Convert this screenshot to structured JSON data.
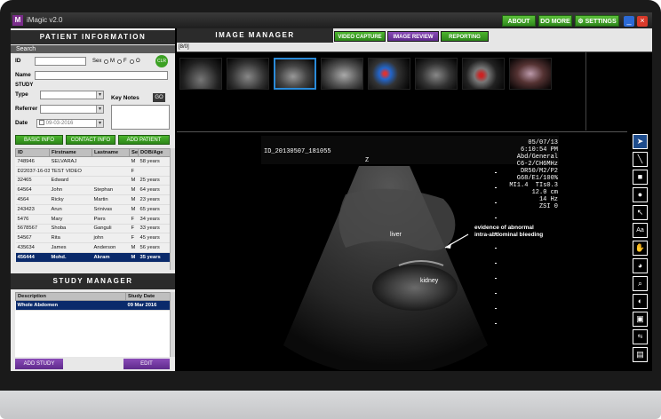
{
  "window": {
    "title": "iMagic v2.0",
    "buttons": {
      "about": "ABOUT",
      "do_more": "DO MORE",
      "settings": "SETTINGS"
    }
  },
  "patient_info": {
    "header": "PATIENT INFORMATION",
    "search_label": "Search",
    "id_label": "ID",
    "sex_label": "Sex",
    "sex_options": [
      "M",
      "F",
      "O"
    ],
    "clr_label": "CLR",
    "name_label": "Name",
    "study_label": "STUDY",
    "type_label": "Type",
    "key_notes_label": "Key Notes",
    "go_label": "GO",
    "referrer_label": "Referrer",
    "date_label": "Date",
    "date_value": "09-03-2016",
    "buttons": {
      "basic_info": "BASIC INFO",
      "contact_info": "CONTACT INFO",
      "add_patient": "ADD PATIENT"
    }
  },
  "patient_table": {
    "columns": [
      "ID",
      "Firstname",
      "Lastname",
      "Sex",
      "DOB/Age"
    ],
    "rows": [
      [
        "748946",
        "SELVARAJ",
        "",
        "M",
        "58 years"
      ],
      [
        "D22037-16-03",
        "TEST VIDEO",
        "",
        "F",
        ""
      ],
      [
        "32465",
        "Edward",
        "",
        "M",
        "25 years"
      ],
      [
        "64564",
        "John",
        "Stephan",
        "M",
        "64 years"
      ],
      [
        "4564",
        "Ricky",
        "Martin",
        "M",
        "23 years"
      ],
      [
        "243423",
        "Arun",
        "Srinivas",
        "M",
        "65 years"
      ],
      [
        "5476",
        "Mary",
        "Piers",
        "F",
        "34 years"
      ],
      [
        "5678567",
        "Shoba",
        "Ganguli",
        "F",
        "33 years"
      ],
      [
        "54567",
        "Rita",
        "john",
        "F",
        "45 years"
      ],
      [
        "435634",
        "James",
        "Anderson",
        "M",
        "56 years"
      ],
      [
        "456444",
        "Mohd.",
        "Akram",
        "M",
        "35 years"
      ]
    ],
    "selected_index": 10
  },
  "study_manager": {
    "header": "STUDY MANAGER",
    "columns": [
      "Description",
      "Study Date"
    ],
    "rows": [
      [
        "Whole Abdomen",
        "09 Mar 2016"
      ]
    ],
    "add_study": "ADD STUDY",
    "edit": "EDIT"
  },
  "image_manager": {
    "header": "IMAGE MANAGER",
    "tabs": [
      "VIDEO CAPTURE",
      "IMAGE REVIEW",
      "REPORTING"
    ],
    "active_tab": "IMAGE REVIEW",
    "counter": "[8/0]",
    "thumbnail_count": 8,
    "selected_thumbnail": 3
  },
  "viewer": {
    "image_id": "ID_20130507_181055",
    "date": "05/07/13",
    "time": "6:10:54 PM",
    "params": [
      "Abd/General",
      "C6-2/CH6MHz",
      "DR50/M2/P2",
      "G68/E1/100%",
      "MI1.4  TIs0.3",
      "12.0 cm",
      "14 Hz",
      "ZSI 0"
    ],
    "labels": {
      "liver": "liver",
      "kidney": "kidney",
      "annotation_line1": "evidence of abnormal",
      "annotation_line2": "intra-abdominal bleeding"
    },
    "probe_mark": "Z"
  },
  "tools": [
    "pointer",
    "line",
    "rectangle",
    "ellipse",
    "arrow",
    "text",
    "pan",
    "contrast",
    "zoom",
    "invert",
    "fit",
    "flip",
    "save"
  ]
}
